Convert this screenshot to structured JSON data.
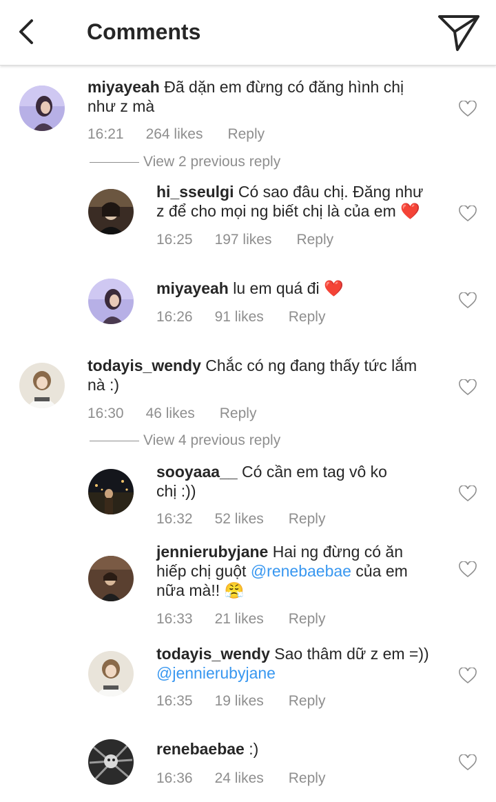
{
  "header": {
    "title": "Comments"
  },
  "comments": [
    {
      "username": "miyayeah",
      "text_lines": [
        "Đã dặn em đừng có đăng hình chị",
        "như z mà"
      ],
      "time": "16:21",
      "likes": "264 likes",
      "reply": "Reply",
      "view_previous": "View 2 previous reply"
    },
    {
      "username": "hi_sseulgi",
      "text_lines": [
        "Có sao đâu chị. Đăng như",
        "z để cho mọi ng biết chị là của em"
      ],
      "emoji": "❤️",
      "time": "16:25",
      "likes": "197 likes",
      "reply": "Reply"
    },
    {
      "username": "miyayeah",
      "text_lines": [
        "lu em quá đi"
      ],
      "emoji": "❤️",
      "time": "16:26",
      "likes": "91 likes",
      "reply": "Reply"
    },
    {
      "username": "todayis_wendy",
      "text_lines": [
        "Chắc có ng đang thấy tức lắm",
        "nà :)"
      ],
      "time": "16:30",
      "likes": "46 likes",
      "reply": "Reply",
      "view_previous": "View 4 previous reply"
    },
    {
      "username": "sooyaaa__",
      "text_lines": [
        "Có cần em tag vô ko",
        "chị :))"
      ],
      "time": "16:32",
      "likes": "52 likes",
      "reply": "Reply"
    },
    {
      "username": "jennierubyjane",
      "text_lines": [
        "Hai ng đừng có ăn",
        "hiếp chị guột",
        "của em",
        "nữa mà!!"
      ],
      "mention": "@renebaebae",
      "emoji": "😤",
      "time": "16:33",
      "likes": "21 likes",
      "reply": "Reply"
    },
    {
      "username": "todayis_wendy",
      "text_lines": [
        "Sao thâm dữ z em =))"
      ],
      "mention": "@jennierubyjane",
      "time": "16:35",
      "likes": "19 likes",
      "reply": "Reply"
    },
    {
      "username": "renebaebae",
      "text_lines": [
        ":)"
      ],
      "time": "16:36",
      "likes": "24 likes",
      "reply": "Reply"
    }
  ],
  "colors": {
    "accent_link": "#3897f0",
    "meta_gray": "#8e8e8e",
    "text": "#262626"
  }
}
